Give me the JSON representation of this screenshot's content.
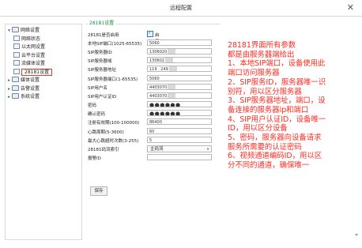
{
  "window": {
    "title": "远程配置",
    "close_glyph": "✕"
  },
  "tree": {
    "items": [
      {
        "label": "网络设置",
        "expander": "▾",
        "icon": "folder-icon",
        "level": 0
      },
      {
        "label": "网络状态",
        "icon": "page-icon",
        "level": 1
      },
      {
        "label": "以太网设置",
        "icon": "page-icon",
        "level": 1
      },
      {
        "label": "云平台设置",
        "icon": "page-icon",
        "level": 1
      },
      {
        "label": "流媒体设置",
        "icon": "page-icon",
        "level": 1
      },
      {
        "label": "28181设置",
        "icon": "page-icon",
        "level": 1,
        "selected": true
      },
      {
        "label": "媒体设置",
        "expander": "▸",
        "icon": "folder-icon",
        "level": 0
      },
      {
        "label": "告警设置",
        "expander": "▸",
        "icon": "folder-icon",
        "level": 0
      },
      {
        "label": "系统设置",
        "expander": "▸",
        "icon": "folder-icon",
        "level": 0
      }
    ]
  },
  "form": {
    "title": "28181设置",
    "enable": {
      "label": "28181是否启用",
      "checked": true,
      "checkbox_label": "启用"
    },
    "fields": [
      {
        "label": "本地SIP端口(1025-65535)",
        "value": "5060",
        "type": "text"
      },
      {
        "label": "SIP服务器ID",
        "value": "1306020",
        "type": "text",
        "masked": true
      },
      {
        "label": "SIP服务器域",
        "value": "130602",
        "type": "text",
        "masked": true
      },
      {
        "label": "SIP服务器地址",
        "value": "119 . 249",
        "type": "text",
        "masked": true
      },
      {
        "label": "SIP服务器端口(1-65535)",
        "value": "5060",
        "type": "text"
      },
      {
        "label": "SIP用户名",
        "value": "4403070",
        "type": "text",
        "masked": true
      },
      {
        "label": "SIP用户认证ID",
        "value": "4403070",
        "type": "text",
        "masked": true
      },
      {
        "label": "密码",
        "value": "●●●●●●",
        "type": "password"
      },
      {
        "label": "确认密码",
        "value": "●●●●●●",
        "type": "password"
      },
      {
        "label": "注册有效期(100-100000)",
        "value": "86400",
        "type": "text"
      },
      {
        "label": "心跳周期(5-3600)",
        "value": "60",
        "type": "text"
      },
      {
        "label": "最大心跳超时次数(3-255)",
        "value": "5",
        "type": "text"
      },
      {
        "label": "28181码流索引",
        "value": "主码流",
        "type": "select"
      },
      {
        "label": "报警ID",
        "value": "",
        "type": "text"
      }
    ],
    "save_label": "保存"
  },
  "annotation": {
    "lines": [
      "28181界面所有参数",
      "都是由服务器端给出",
      "1、本地SIP端口，设备使用此",
      "端口访问服务器",
      "2、SIP服务ID，服务器唯一识",
      "别符，用以区分服务器",
      "3、SIP服务器地址，端口，设",
      "备连接的服务器ip和端口",
      "4、SIP用户认证ID，设备唯一",
      "ID，用以区分设备",
      "5、密码，服务器向设备请求",
      "服务所需要的认证密码",
      "6、视频通道编码ID，用以区",
      "分不同的通道，确保唯一"
    ],
    "color": "#ff2a1f"
  },
  "colors": {
    "accent_green": "#1a8a3a",
    "selection_border": "#e23a2c",
    "checkbox_blue": "#3b78c8"
  }
}
